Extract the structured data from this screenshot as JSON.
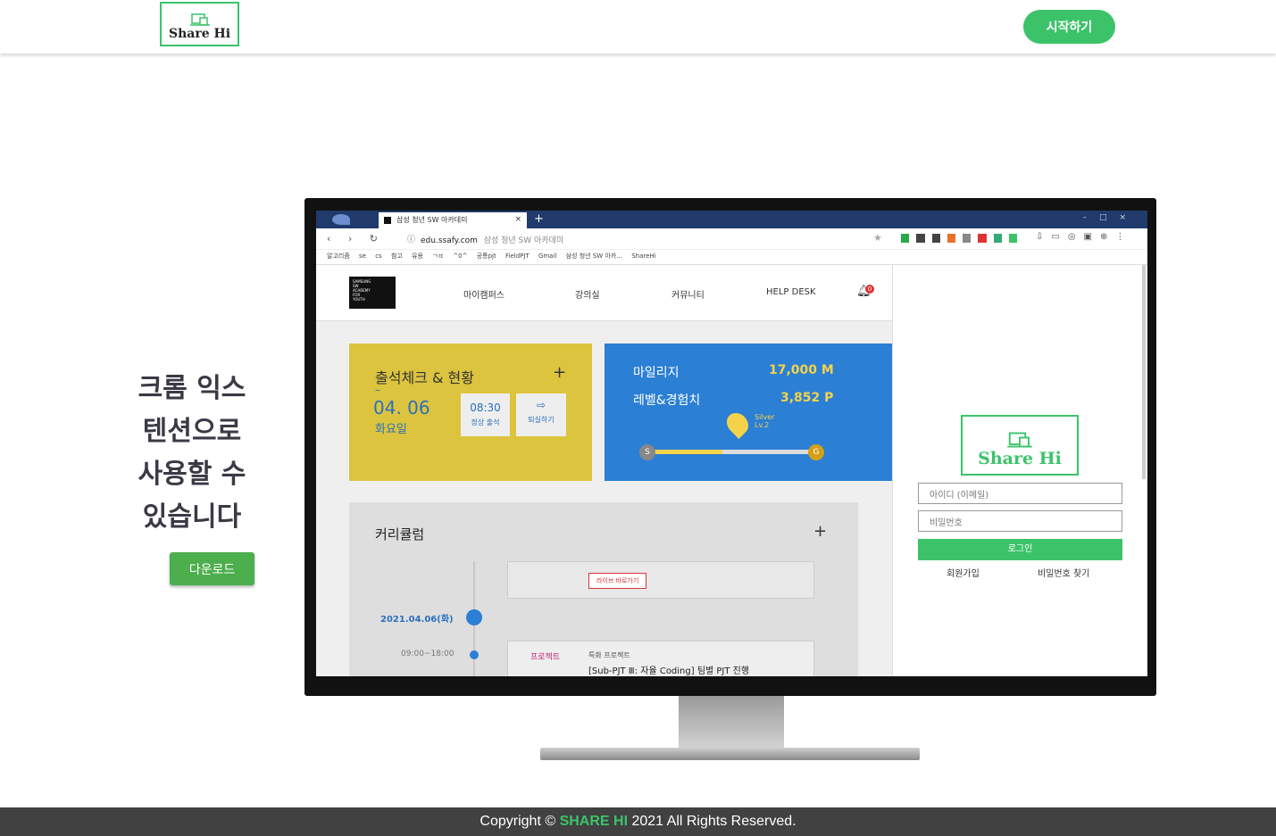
{
  "header": {
    "logo_text": "Share Hi",
    "start_button": "시작하기"
  },
  "hero": {
    "tagline_lines": [
      "크롬 익스",
      "텐션으로",
      "사용할 수",
      "있습니다"
    ],
    "download_button": "다운로드"
  },
  "browser": {
    "tab_title": "삼성 청년 SW 아카데미",
    "url_domain": "edu.ssafy.com",
    "url_title": "삼성 청년 SW 아카데미",
    "bookmarks": [
      "알고리즘",
      "se",
      "cs",
      "참고",
      "유용",
      "ㄱㄸ",
      "^0^",
      "공통pjt",
      "FieldPJT",
      "Gmail",
      "삼성 청년 SW 아카...",
      "ShareHi"
    ]
  },
  "site": {
    "logo_lines": [
      "SAMSUNG",
      "SW",
      "ACADEMY",
      "FOR",
      "YOUTH"
    ],
    "nav": [
      "마이캠퍼스",
      "강의실",
      "커뮤니티",
      "HELP DESK"
    ],
    "notification_count": "0",
    "attendance": {
      "title": "출석체크 & 현황",
      "dash": "–",
      "date": "04. 06",
      "weekday": "화요일",
      "time": "08:30",
      "status": "정상 출석",
      "exit_label": "퇴실하기",
      "plus": "+"
    },
    "mileage": {
      "label1": "마일리지",
      "value1": "17,000 M",
      "label2": "레벨&경험치",
      "value2": "3,852 P",
      "badge_line1": "Silver",
      "badge_line2": "Lv.2",
      "left_marker": "S",
      "right_marker": "G",
      "progress": 0.44
    },
    "curriculum": {
      "title": "커리큘럼",
      "plus": "+",
      "live_button": "라이브 바로가기",
      "date": "2021.04.06(화)",
      "time": "09:00~18:00",
      "tag": "프로젝트",
      "tag_detail": "특화 프로젝트",
      "desc": "[Sub-PJT Ⅲ: 자율 Coding] 팀별 PJT 진행"
    }
  },
  "popup": {
    "logo_text": "Share Hi",
    "id_placeholder": "아이디 (이메일)",
    "pw_placeholder": "비밀번호",
    "login_button": "로그인",
    "signup_link": "회원가입",
    "find_pw_link": "비밀번호 찾기"
  },
  "footer": {
    "prefix": "Copyright ©",
    "brand": "SHARE HI",
    "suffix": "2021 All Rights Reserved."
  },
  "colors": {
    "brand_green": "#3cc36a",
    "download_green": "#4cae4c",
    "attendance_yellow": "#dcc43e",
    "mileage_blue": "#2b7fd4",
    "footer_bg": "#414141"
  }
}
